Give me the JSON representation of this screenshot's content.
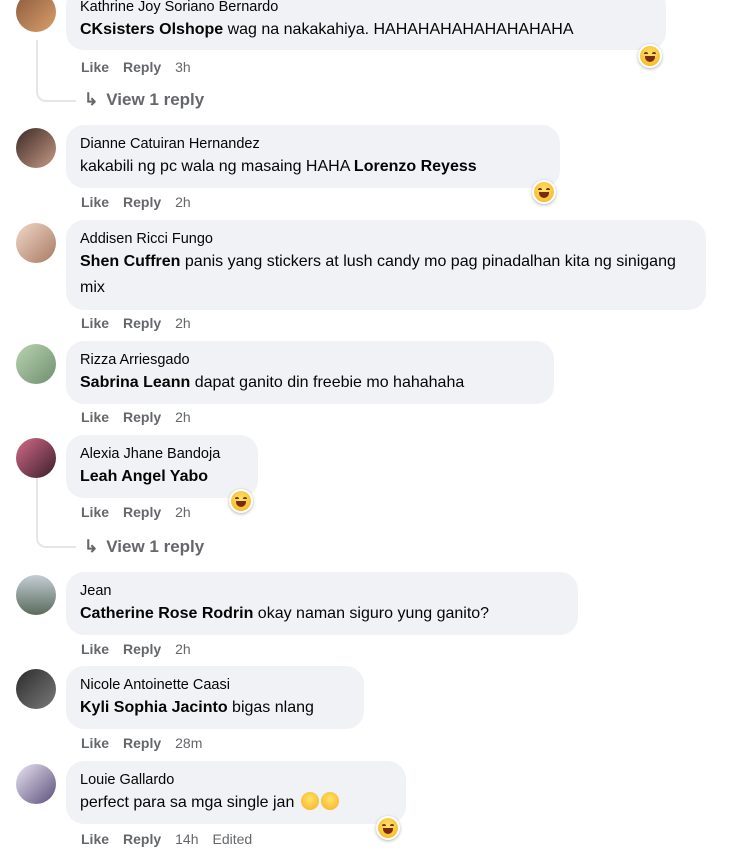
{
  "actions": {
    "like": "Like",
    "reply": "Reply"
  },
  "view_reply": "View 1 reply",
  "comments": [
    {
      "author": "Kathrine Joy Soriano Bernardo",
      "mention": "CKsisters Olshope",
      "text": " wag na nakakahiya. HAHAHAHAHAHAHAHAHA",
      "time": "3h"
    },
    {
      "author": "Dianne Catuiran Hernandez",
      "mention": "",
      "text": "kakabili ng pc wala ng masaing HAHA ",
      "mention_after": "Lorenzo Reyess",
      "time": "2h"
    },
    {
      "author": "Addisen Ricci Fungo",
      "mention": "Shen Cuffren",
      "text": " panis yang stickers at lush candy mo pag pinadalhan kita ng sinigang mix",
      "time": "2h"
    },
    {
      "author": "Rizza Arriesgado",
      "mention": "Sabrina Leann",
      "text": " dapat ganito din freebie mo hahahaha",
      "time": "2h"
    },
    {
      "author": "Alexia Jhane Bandoja",
      "mention": "Leah Angel Yabo",
      "text": "",
      "time": "2h"
    },
    {
      "author": "Jean",
      "mention": "Catherine Rose Rodrin",
      "text": " okay naman siguro yung ganito?",
      "time": "2h"
    },
    {
      "author": "Nicole Antoinette Caasi",
      "mention": "Kyli Sophia Jacinto",
      "text": " bigas nlang",
      "time": "28m"
    },
    {
      "author": "Louie Gallardo",
      "mention": "",
      "text": "perfect para sa mga single jan ",
      "time": "14h",
      "edited": "Edited"
    }
  ],
  "reaction_icon": "haha-emoji-icon"
}
